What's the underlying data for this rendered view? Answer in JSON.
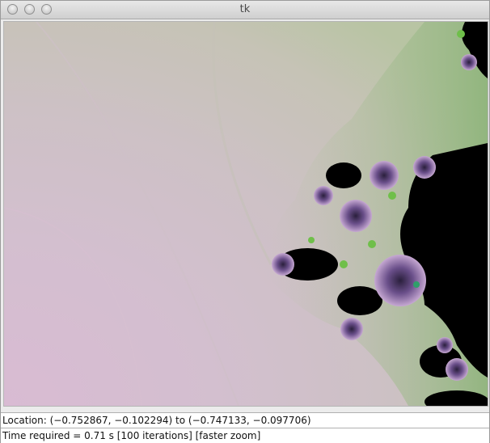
{
  "window": {
    "title": "tk",
    "buttons": [
      "close",
      "minimize",
      "zoom"
    ]
  },
  "canvas": {
    "description_icon": "fractal-canvas",
    "colors": {
      "exterior_light": "#d9bdd2",
      "exterior_mid": "#cdbfc4",
      "exterior_gray": "#c5c2b6",
      "exterior_green": "#8fb07a",
      "set_interior": "#000000",
      "spiral_purple": "#7a5d96",
      "spiral_light": "#c9aed3"
    }
  },
  "status": {
    "location": "Location: (−0.752867, −0.102294) to (−0.747133, −0.097706)",
    "time": "Time required = 0.71 s  [100 iterations]  [faster zoom]"
  }
}
